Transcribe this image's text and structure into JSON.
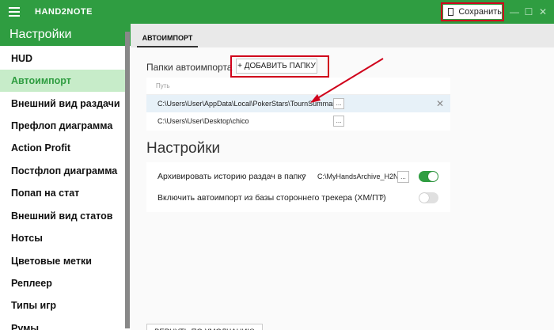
{
  "app": {
    "title": "HAND2NOTE",
    "save_label": "Сохранить"
  },
  "window_controls": [
    "—",
    "☐",
    "✕"
  ],
  "sidebar": {
    "header": "Настройки",
    "items": [
      {
        "label": "HUD",
        "active": false
      },
      {
        "label": "Автоимпорт",
        "active": true
      },
      {
        "label": "Внешний вид раздачи",
        "active": false
      },
      {
        "label": "Префлоп диаграмма",
        "active": false
      },
      {
        "label": "Action Profit",
        "active": false
      },
      {
        "label": "Постфлоп диаграмма",
        "active": false
      },
      {
        "label": "Попап на стат",
        "active": false
      },
      {
        "label": "Внешний вид статов",
        "active": false
      },
      {
        "label": "Нотсы",
        "active": false
      },
      {
        "label": "Цветовые метки",
        "active": false
      },
      {
        "label": "Реплеер",
        "active": false
      },
      {
        "label": "Типы игр",
        "active": false
      },
      {
        "label": "Румы",
        "active": false
      }
    ]
  },
  "main": {
    "tab_label": "АВТОИМПОРТ",
    "folders_label": "Папки автоимпорта",
    "add_folder_label": "+ ДОБАВИТЬ ПАПКУ",
    "table_header": "Путь",
    "folders": [
      {
        "path": "C:\\Users\\User\\AppData\\Local\\PokerStars\\TournSummary",
        "dots": "...",
        "remove": "✕"
      },
      {
        "path": "C:\\Users\\User\\Desktop\\chico",
        "dots": "..."
      }
    ],
    "settings_title": "Настройки",
    "settings": [
      {
        "label": "Архивировать историю раздач в папку",
        "help": "?",
        "path": "C:\\MyHandsArchive_H2N",
        "dots": "...",
        "enabled": true
      },
      {
        "label": "Включить автоимпорт из базы стороннего трекера (ХМ/ПТ)",
        "help": "?",
        "enabled": false
      }
    ],
    "reset_label": "ВЕРНУТЬ ПО УМОЛЧАНИЮ"
  },
  "colors": {
    "brand_green": "#2f9d41",
    "active_item_bg": "#c7ecc9",
    "annotation_red": "#d0021b"
  }
}
